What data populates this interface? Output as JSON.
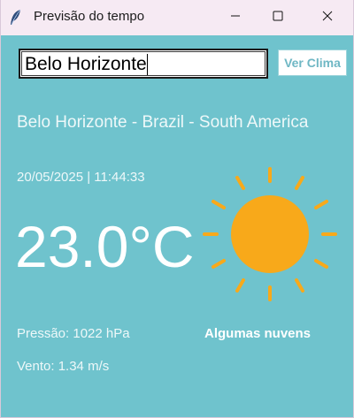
{
  "window": {
    "title": "Previsão do tempo",
    "app_icon": "feather-icon",
    "controls": [
      "minimize-icon",
      "maximize-icon",
      "close-icon"
    ]
  },
  "search": {
    "value": "Belo Horizonte",
    "button_label": "Ver Clima"
  },
  "weather": {
    "location": "Belo Horizonte - Brazil - South America",
    "datetime": "20/05/2025 | 11:44:33",
    "temperature": "23.0°C",
    "icon": "sun-icon",
    "pressure": "Pressão: 1022 hPa",
    "description": "Algumas nuvens",
    "wind": "Vento: 1.34 m/s"
  },
  "colors": {
    "background": "#6fc3cd",
    "titlebar": "#f6eaf3",
    "sun": "#f8a91a",
    "button_text": "#6fb7c4"
  }
}
